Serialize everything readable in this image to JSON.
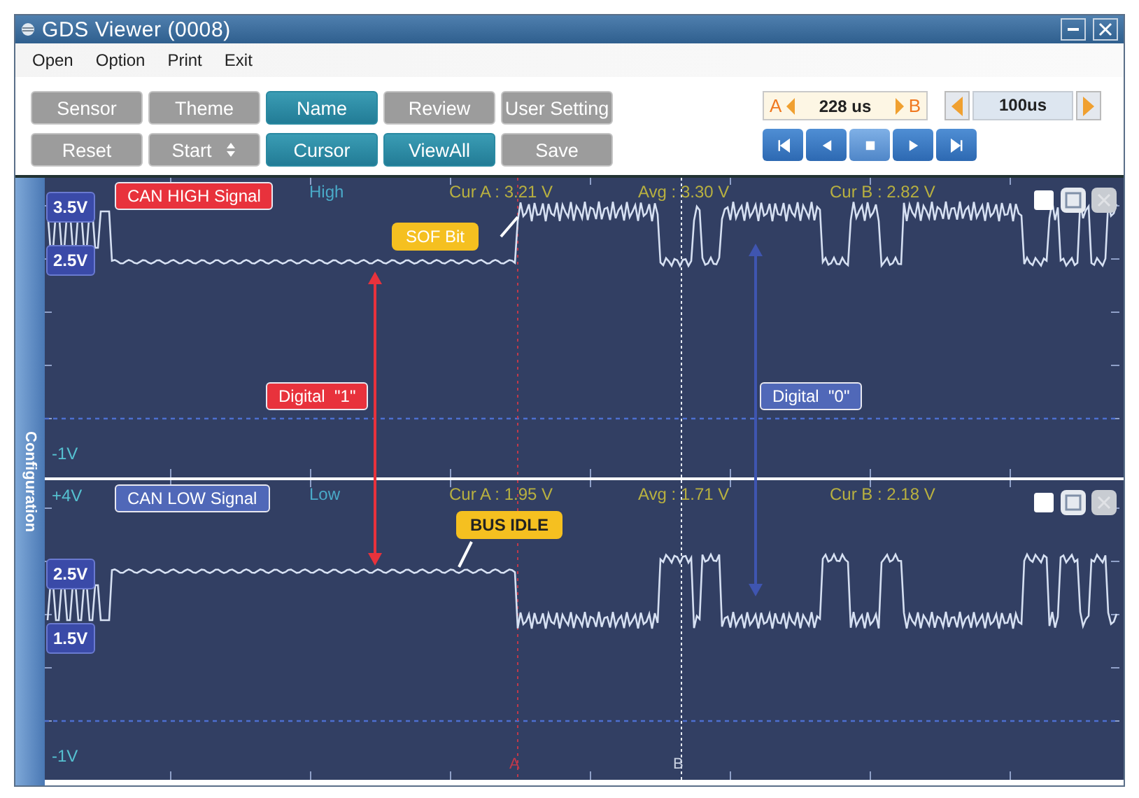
{
  "window": {
    "title": "GDS Viewer (0008)"
  },
  "menu": [
    "Open",
    "Option",
    "Print",
    "Exit"
  ],
  "button_rows": [
    [
      {
        "label": "Sensor",
        "selected": false,
        "kind": "plain"
      },
      {
        "label": "Theme",
        "selected": false,
        "kind": "plain"
      },
      {
        "label": "Name",
        "selected": true,
        "kind": "plain"
      },
      {
        "label": "Review",
        "selected": false,
        "kind": "plain"
      },
      {
        "label": "User Setting",
        "selected": false,
        "kind": "plain"
      }
    ],
    [
      {
        "label": "Reset",
        "selected": false,
        "kind": "plain"
      },
      {
        "label": "Start",
        "selected": false,
        "kind": "spinner"
      },
      {
        "label": "Cursor",
        "selected": true,
        "kind": "plain"
      },
      {
        "label": "ViewAll",
        "selected": true,
        "kind": "plain"
      },
      {
        "label": "Save",
        "selected": false,
        "kind": "plain"
      }
    ]
  ],
  "time_display": {
    "label_a": "A",
    "value": "228 us",
    "label_b": "B"
  },
  "scale": {
    "value": "100us"
  },
  "playback": [
    {
      "kind": "first",
      "selected": false
    },
    {
      "kind": "prev",
      "selected": false
    },
    {
      "kind": "stop",
      "selected": true
    },
    {
      "kind": "next",
      "selected": false
    },
    {
      "kind": "last",
      "selected": false
    }
  ],
  "side_tab": "Configuration",
  "channels": [
    {
      "kind": "high",
      "name": "CAN HIGH Signal",
      "color": "#e8323c",
      "mode": "High",
      "bottom_scale": "-1V",
      "cur_a": "Cur A : 3.21 V",
      "avg": "Avg : 3.30 V",
      "cur_b": "Cur B : 2.82 V",
      "level_markers": [
        "3.5V",
        "2.5V"
      ],
      "callout": {
        "text": "SOF Bit",
        "bold": false
      }
    },
    {
      "kind": "low",
      "name": "CAN LOW Signal",
      "color": "#5068b8",
      "mode": "Low",
      "top_scale": "+4V",
      "bottom_scale": "-1V",
      "cur_a": "Cur A : 1.95 V",
      "avg": "Avg : 1.71 V",
      "cur_b": "Cur B : 2.18 V",
      "level_markers": [
        "2.5V",
        "1.5V"
      ],
      "callout": {
        "text": "BUS IDLE",
        "bold": true
      },
      "cursor_a_label": "A",
      "cursor_b_label": "B"
    }
  ],
  "annotations": [
    {
      "text": "Digital  \"1\"",
      "color": "#e8323c"
    },
    {
      "text": "Digital  \"0\"",
      "color": "#5068b8"
    }
  ]
}
